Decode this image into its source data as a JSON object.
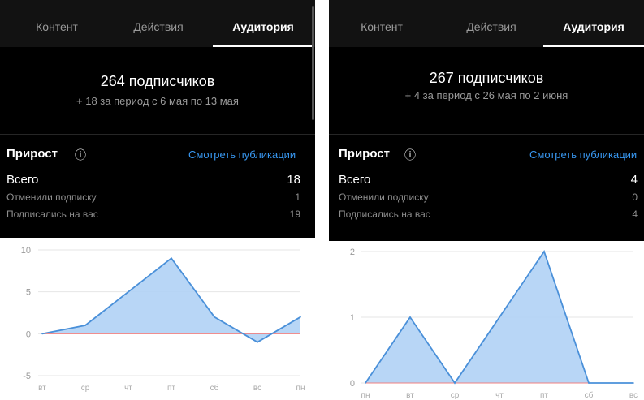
{
  "left": {
    "tabs": [
      "Контент",
      "Действия",
      "Аудитория"
    ],
    "active_tab": 2,
    "subscribers": "264 подписчиков",
    "period": "+ 18 за период с 6 мая по 13 мая",
    "growth_title": "Прирост",
    "info_icon": "ⓘ",
    "see_posts": "Смотреть публикации",
    "rows": [
      {
        "label": "Всего",
        "value": "18"
      },
      {
        "label": "Отменили подписку",
        "value": "1"
      },
      {
        "label": "Подписались на вас",
        "value": "19"
      }
    ]
  },
  "right": {
    "tabs": [
      "Контент",
      "Действия",
      "Аудитория"
    ],
    "active_tab": 2,
    "subscribers": "267 подписчиков",
    "period": "+ 4 за период с 26 мая по 2 июня",
    "growth_title": "Прирост",
    "info_icon": "ⓘ",
    "see_posts": "Смотреть публикации",
    "rows": [
      {
        "label": "Всего",
        "value": "4"
      },
      {
        "label": "Отменили подписку",
        "value": "0"
      },
      {
        "label": "Подписались на вас",
        "value": "4"
      }
    ]
  },
  "colors": {
    "fill": "#b0d2f5",
    "line": "#4a90d9",
    "link": "#3897f0",
    "baseline": "#f08080"
  },
  "chart_data": [
    {
      "type": "area",
      "categories": [
        "вт",
        "ср",
        "чт",
        "пт",
        "сб",
        "вс",
        "пн"
      ],
      "values": [
        0,
        1,
        5,
        9,
        2,
        -1,
        2
      ],
      "ylim": [
        -5,
        10
      ],
      "yticks": [
        "-5",
        "0",
        "5",
        "10"
      ],
      "grid": true
    },
    {
      "type": "area",
      "categories": [
        "пн",
        "вт",
        "ср",
        "чт",
        "пт",
        "сб",
        "вс"
      ],
      "values": [
        0,
        1,
        0,
        1,
        2,
        0,
        0
      ],
      "ylim": [
        0,
        2
      ],
      "yticks": [
        "0",
        "1",
        "2"
      ],
      "grid": true
    }
  ]
}
